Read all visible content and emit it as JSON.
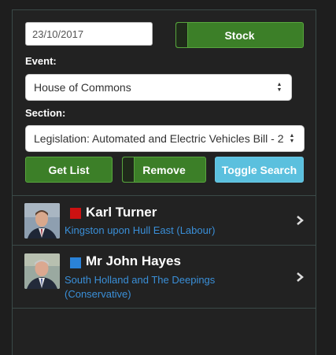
{
  "controls": {
    "date_value": "23/10/2017",
    "stock_label": "Stock",
    "event_label": "Event:",
    "event_selected": "House of Commons",
    "section_label": "Section:",
    "section_selected": "Legislation: Automated and Electric Vehicles Bill - 2",
    "get_list_label": "Get List",
    "remove_label": "Remove",
    "toggle_search_label": "Toggle Search"
  },
  "members": [
    {
      "name": "Karl Turner",
      "constituency": "Kingston upon Hull East (Labour)",
      "party_color": "#cc1111"
    },
    {
      "name": "Mr John Hayes",
      "constituency_line1": "South Holland and The Deepings",
      "constituency_line2": "(Conservative)",
      "party_color": "#2a82d8"
    }
  ],
  "icons": {
    "select_arrows": "updown-caret-icon",
    "chevron": "chevron-right-icon"
  }
}
